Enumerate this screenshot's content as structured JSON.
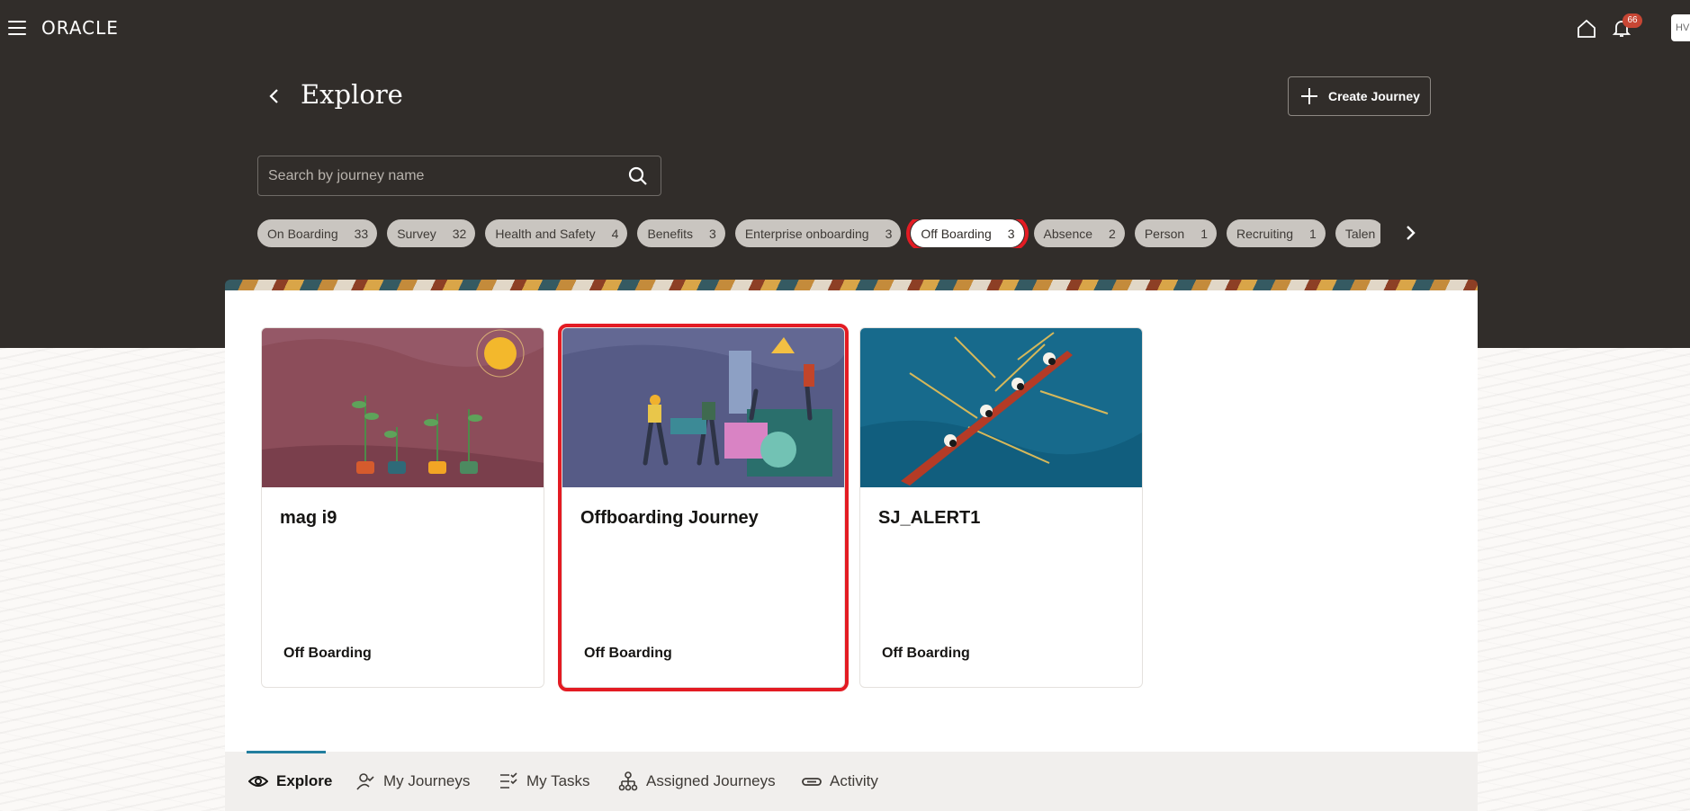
{
  "topbar": {
    "logo": "ORACLE",
    "notification_count": "66",
    "avatar_initials": "HV"
  },
  "header": {
    "title": "Explore",
    "create_button": "Create Journey"
  },
  "search": {
    "placeholder": "Search by journey name",
    "value": ""
  },
  "categories": [
    {
      "label": "On Boarding",
      "count": "33"
    },
    {
      "label": "Survey",
      "count": "32"
    },
    {
      "label": "Health and Safety",
      "count": "4"
    },
    {
      "label": "Benefits",
      "count": "3"
    },
    {
      "label": "Enterprise onboarding",
      "count": "3"
    },
    {
      "label": "Off Boarding",
      "count": "3",
      "selected": true
    },
    {
      "label": "Absence",
      "count": "2"
    },
    {
      "label": "Person",
      "count": "1"
    },
    {
      "label": "Recruiting",
      "count": "1"
    },
    {
      "label": "Talen",
      "count": ""
    }
  ],
  "cards": [
    {
      "title": "mag i9",
      "category": "Off Boarding"
    },
    {
      "title": "Offboarding Journey",
      "category": "Off Boarding",
      "selected": true
    },
    {
      "title": "SJ_ALERT1",
      "category": "Off Boarding"
    }
  ],
  "tabs": [
    {
      "label": "Explore",
      "icon": "eye-icon",
      "active": true
    },
    {
      "label": "My Journeys",
      "icon": "person-check-icon"
    },
    {
      "label": "My Tasks",
      "icon": "checklist-icon"
    },
    {
      "label": "Assigned Journeys",
      "icon": "hierarchy-icon"
    },
    {
      "label": "Activity",
      "icon": "link-icon"
    }
  ],
  "colors": {
    "hero_background": "#312d2a",
    "selection_outline": "#e31b23",
    "badge": "#c74634",
    "tab_accent": "#227e9e"
  }
}
